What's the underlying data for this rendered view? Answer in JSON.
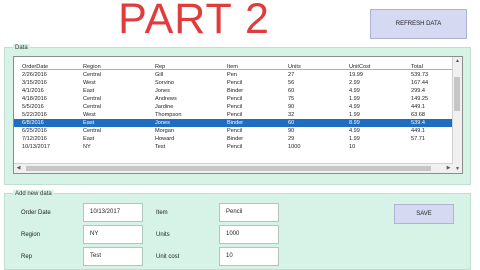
{
  "title": "PART 2",
  "buttons": {
    "refresh": "REFRESH DATA",
    "save": "SAVE"
  },
  "data_frame": {
    "label": "Data",
    "columns": [
      "OrderDate",
      "Region",
      "Rep",
      "Item",
      "Units",
      "UnitCost",
      "Total"
    ],
    "rows": [
      [
        "2/26/2016",
        "Central",
        "Gill",
        "Pen",
        "27",
        "19.99",
        "539.73"
      ],
      [
        "3/15/2016",
        "West",
        "Sorvino",
        "Pencil",
        "56",
        "2.99",
        "167.44"
      ],
      [
        "4/1/2016",
        "East",
        "Jones",
        "Binder",
        "60",
        "4.99",
        "299.4"
      ],
      [
        "4/18/2016",
        "Central",
        "Andrews",
        "Pencil",
        "75",
        "1.99",
        "149.25"
      ],
      [
        "5/5/2016",
        "Central",
        "Jardine",
        "Pencil",
        "90",
        "4.99",
        "449.1"
      ],
      [
        "5/22/2016",
        "West",
        "Thompson",
        "Pencil",
        "32",
        "1.99",
        "63.68"
      ],
      [
        "6/8/2016",
        "East",
        "Jones",
        "Binder",
        "60",
        "8.99",
        "539.4"
      ],
      [
        "6/25/2016",
        "Central",
        "Morgan",
        "Pencil",
        "90",
        "4.99",
        "449.1"
      ],
      [
        "7/12/2016",
        "East",
        "Howard",
        "Binder",
        "29",
        "1.99",
        "57.71"
      ],
      [
        "10/13/2017",
        "NY",
        "Test",
        "Pencil",
        "1000",
        "10",
        ""
      ]
    ],
    "selected_row": 6
  },
  "add_frame": {
    "label": "Add new data",
    "order_date_label": "Order Date",
    "order_date_value": "10/13/2017",
    "region_label": "Region",
    "region_value": "NY",
    "rep_label": "Rep",
    "rep_value": "Test",
    "item_label": "Item",
    "item_value": "Pencil",
    "units_label": "Units",
    "units_value": "1000",
    "unit_cost_label": "Unit cost",
    "unit_cost_value": "10"
  },
  "colors": {
    "title": "#e03c3c",
    "frame_bg": "#d7f3e7",
    "button_bg": "#d6d9f2",
    "selection": "#1f6cc3"
  },
  "icons": {
    "scroll_up": "arrow-up-icon",
    "scroll_down": "arrow-down-icon",
    "scroll_left": "arrow-left-icon",
    "scroll_right": "arrow-right-icon"
  }
}
